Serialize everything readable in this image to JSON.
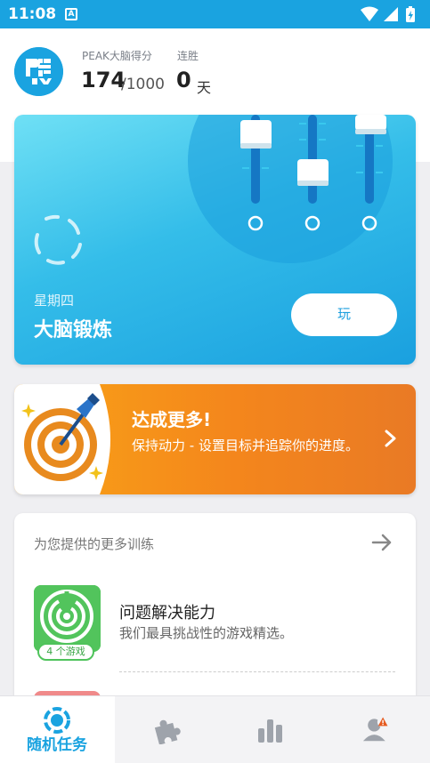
{
  "status_bar": {
    "time": "11:08",
    "notification_icon": "a-notification-icon",
    "icons": [
      "wifi-icon",
      "signal-icon",
      "battery-icon"
    ]
  },
  "header": {
    "logo_icon": "peak-logo",
    "score_label": "PEAK大脑得分",
    "score_value": "174",
    "score_total": "/1000",
    "streak_label": "连胜",
    "streak_value": "0",
    "streak_unit": "天"
  },
  "workout": {
    "day": "星期四",
    "title": "大脑锻炼",
    "play_label": "玩",
    "progress_icon": "progress-ring-icon"
  },
  "goal": {
    "title": "达成更多!",
    "text": "保持动力 - 设置目标并追踪你的进度。",
    "icon": "target-dart-icon"
  },
  "more_training": {
    "title": "为您提供的更多训练",
    "items": [
      {
        "title": "问题解决能力",
        "description": "我们最具挑战性的游戏精选。",
        "count": "4 个游戏",
        "icon": "maze-icon"
      }
    ]
  },
  "tabs": [
    {
      "label": "随机任务",
      "icon": "workout-icon",
      "active": true
    },
    {
      "label": "",
      "icon": "puzzle-icon",
      "active": false
    },
    {
      "label": "",
      "icon": "stats-icon",
      "active": false
    },
    {
      "label": "",
      "icon": "profile-alert-icon",
      "active": false
    }
  ],
  "colors": {
    "brand_blue": "#1aa3e0",
    "goal_orange": "#f4861c",
    "game_green": "#4fc35b"
  }
}
